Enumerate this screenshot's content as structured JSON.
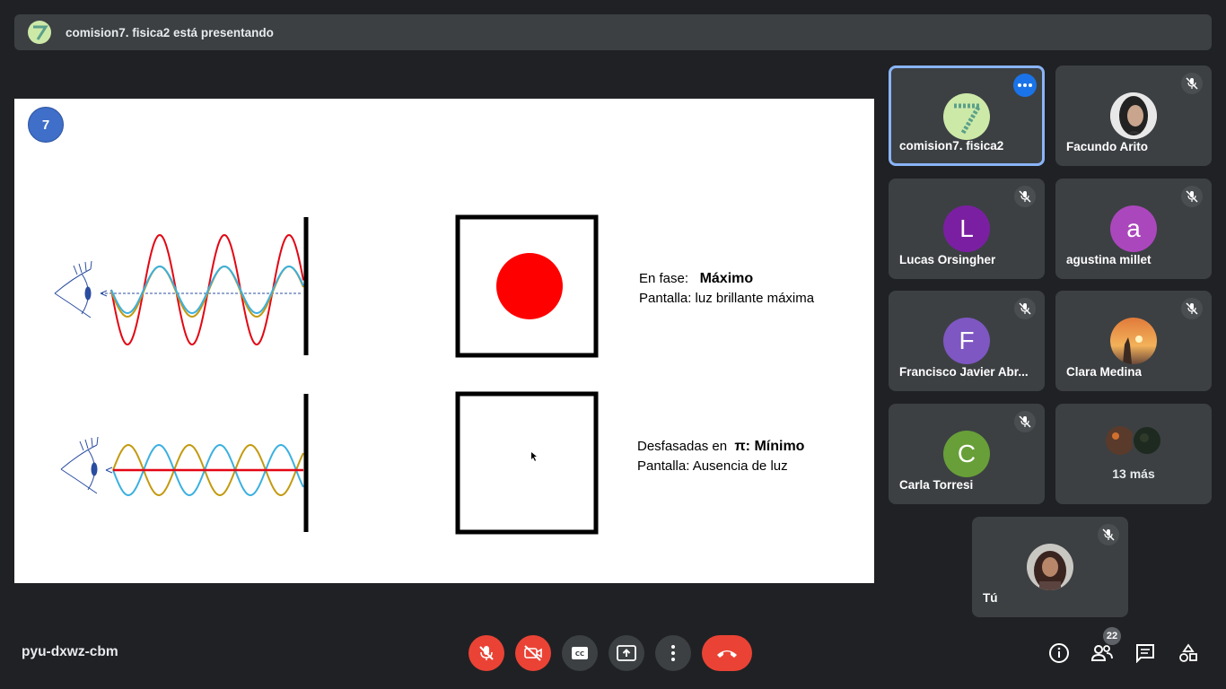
{
  "banner": {
    "text": "comision7. fisica2 está presentando"
  },
  "slide": {
    "number": "7",
    "top_caption": {
      "label": "En fase:",
      "bold": "Máximo",
      "line2": "Pantalla:  luz brillante máxima"
    },
    "bottom_caption": {
      "label": "Desfasadas en",
      "pi": "π",
      "bold": ": Mínimo",
      "line2": "Pantalla:  Ausencia de luz"
    },
    "colors": {
      "red": "#e30613",
      "blue": "#3bb0e0",
      "gold": "#c39a10",
      "spot": "#ff0000"
    }
  },
  "participants": [
    {
      "name": "comision7. fisica2",
      "avatar": "logo-7",
      "active": true
    },
    {
      "name": "Facundo Arito",
      "avatar": "photo",
      "muted": true
    },
    {
      "name": "Lucas Orsingher",
      "initial": "L",
      "color": "#7b1fa2",
      "muted": true
    },
    {
      "name": "agustina millet",
      "initial": "a",
      "color": "#ab47bc",
      "muted": true
    },
    {
      "name": "Francisco Javier Abr...",
      "initial": "F",
      "color": "#7e57c2",
      "muted": true
    },
    {
      "name": "Clara Medina",
      "avatar": "photo",
      "muted": true
    },
    {
      "name": "Carla Torresi",
      "initial": "C",
      "color": "#689f38",
      "muted": true
    },
    {
      "more": "13 más"
    },
    {
      "name": "Tú",
      "avatar": "photo",
      "muted": true
    }
  ],
  "footer": {
    "meeting_code": "pyu-dxwz-cbm",
    "participants_count": "22",
    "icons": [
      "mic-off-icon",
      "camera-off-icon",
      "captions-icon",
      "present-icon",
      "more-vert-icon",
      "end-call-icon",
      "info-icon",
      "people-icon",
      "chat-icon",
      "activities-icon"
    ]
  }
}
